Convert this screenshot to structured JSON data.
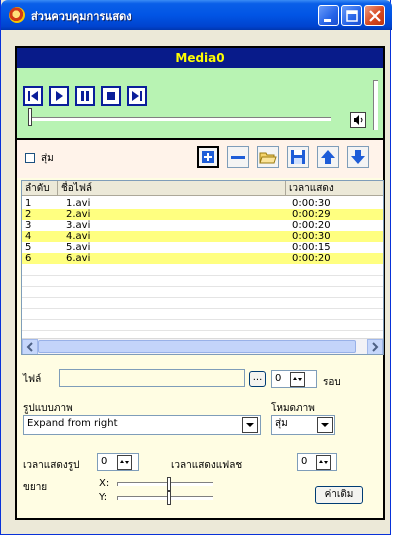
{
  "window": {
    "title": "ส่วนควบคุมการแสดง"
  },
  "player": {
    "name": "Media0",
    "seek_position": 0,
    "volume_level": 1.0
  },
  "toolbar": {
    "random_label": "สุ่ม",
    "random_checked": false
  },
  "playlist": {
    "headers": [
      "ลำดับ",
      "ชื่อไฟล์",
      "เวลาแสดง"
    ],
    "rows": [
      {
        "order": "1",
        "file": "1.avi",
        "time": "0:00:30"
      },
      {
        "order": "2",
        "file": "2.avi",
        "time": "0:00:29"
      },
      {
        "order": "3",
        "file": "3.avi",
        "time": "0:00:20"
      },
      {
        "order": "4",
        "file": "4.avi",
        "time": "0:00:30"
      },
      {
        "order": "5",
        "file": "5.avi",
        "time": "0:00:15"
      },
      {
        "order": "6",
        "file": "6.avi",
        "time": "0:00:20"
      }
    ]
  },
  "form": {
    "file_label": "ไฟล์",
    "file_value": "",
    "browse_label": "...",
    "rounds_value": "0",
    "rounds_label": "รอบ",
    "style_label": "รูปแบบภาพ",
    "style_value": "Expand from right",
    "mode_label": "โหมดภาพ",
    "mode_value": "สุ่ม",
    "image_time_label": "เวลาแสดงรูป",
    "image_time_value": "0",
    "flash_time_label": "เวลาแสดงแฟลช",
    "flash_time_value": "0",
    "zoom_label": "ขยาย",
    "x_label": "X:",
    "y_label": "Y:",
    "reset_label": "ค่าเดิม"
  },
  "colors": {
    "player_bg": "#b8f3b3",
    "player_header": "#081b8a",
    "player_header_text": "#ffff00",
    "panel_bg": "#fffde3",
    "row_highlight": "#ffff80"
  }
}
